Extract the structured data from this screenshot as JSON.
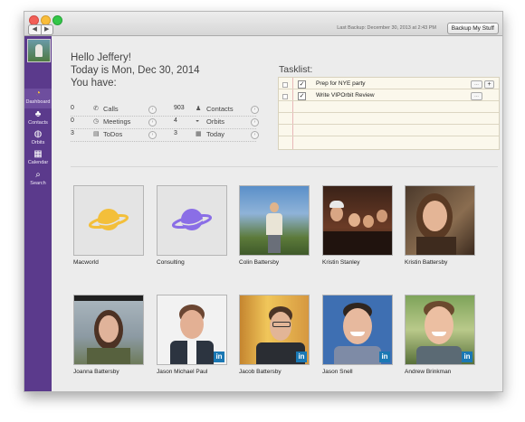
{
  "window": {
    "last_backup": "Last Backup: December 30, 2013 at 2:43 PM",
    "backup_button": "Backup My Stuff",
    "nav_back": "◀",
    "nav_forward": "▶"
  },
  "sidebar": {
    "items": [
      {
        "label": "Dashboard",
        "icon": "dashboard-icon",
        "glyph": "◔"
      },
      {
        "label": "Contacts",
        "icon": "contacts-icon",
        "glyph": "♣"
      },
      {
        "label": "Orbits",
        "icon": "orbits-icon",
        "glyph": "◍"
      },
      {
        "label": "Calendar",
        "icon": "calendar-icon",
        "glyph": "▦"
      },
      {
        "label": "Search",
        "icon": "search-icon",
        "glyph": "⌕"
      }
    ]
  },
  "greeting": {
    "line1": "Hello Jeffery!",
    "line2": "Today is Mon, Dec 30, 2014",
    "line3": "You have:"
  },
  "stats": {
    "left": [
      {
        "count": "0",
        "label": "Calls",
        "icon": "phone-icon",
        "glyph": "✆"
      },
      {
        "count": "0",
        "label": "Meetings",
        "icon": "clock-icon",
        "glyph": "◷"
      },
      {
        "count": "3",
        "label": "ToDos",
        "icon": "clipboard-icon",
        "glyph": "▤"
      }
    ],
    "right": [
      {
        "count": "903",
        "label": "Contacts",
        "icon": "person-icon",
        "glyph": "♟"
      },
      {
        "count": "4",
        "label": "Orbits",
        "icon": "orbit-icon",
        "glyph": "◒"
      },
      {
        "count": "3",
        "label": "Today",
        "icon": "calendar-today-icon",
        "glyph": "▦"
      }
    ],
    "arrow_glyph": "›"
  },
  "tasklist": {
    "title": "Tasklist:",
    "tasks": [
      {
        "text": "Prep for NYE party",
        "checked": "✓",
        "more": "…",
        "add": "+"
      },
      {
        "text": "Write VIPOrbit Review",
        "checked": "✓",
        "more": "…"
      }
    ]
  },
  "cards": [
    {
      "name": "Macworld",
      "kind": "orbit",
      "color": "#f3bf3a"
    },
    {
      "name": "Consulting",
      "kind": "orbit",
      "color": "#8a6ee6"
    },
    {
      "name": "Colin Battersby",
      "kind": "photo"
    },
    {
      "name": "Kristin Stanley",
      "kind": "photo"
    },
    {
      "name": "Kristin Battersby",
      "kind": "photo"
    },
    {
      "name": "Joanna Battersby",
      "kind": "photo"
    },
    {
      "name": "Jason Michael Paul",
      "kind": "photo",
      "linkedin": "in"
    },
    {
      "name": "Jacob Battersby",
      "kind": "photo",
      "linkedin": "in"
    },
    {
      "name": "Jason Snell",
      "kind": "photo",
      "linkedin": "in"
    },
    {
      "name": "Andrew Brinkman",
      "kind": "photo",
      "linkedin": "in"
    }
  ]
}
